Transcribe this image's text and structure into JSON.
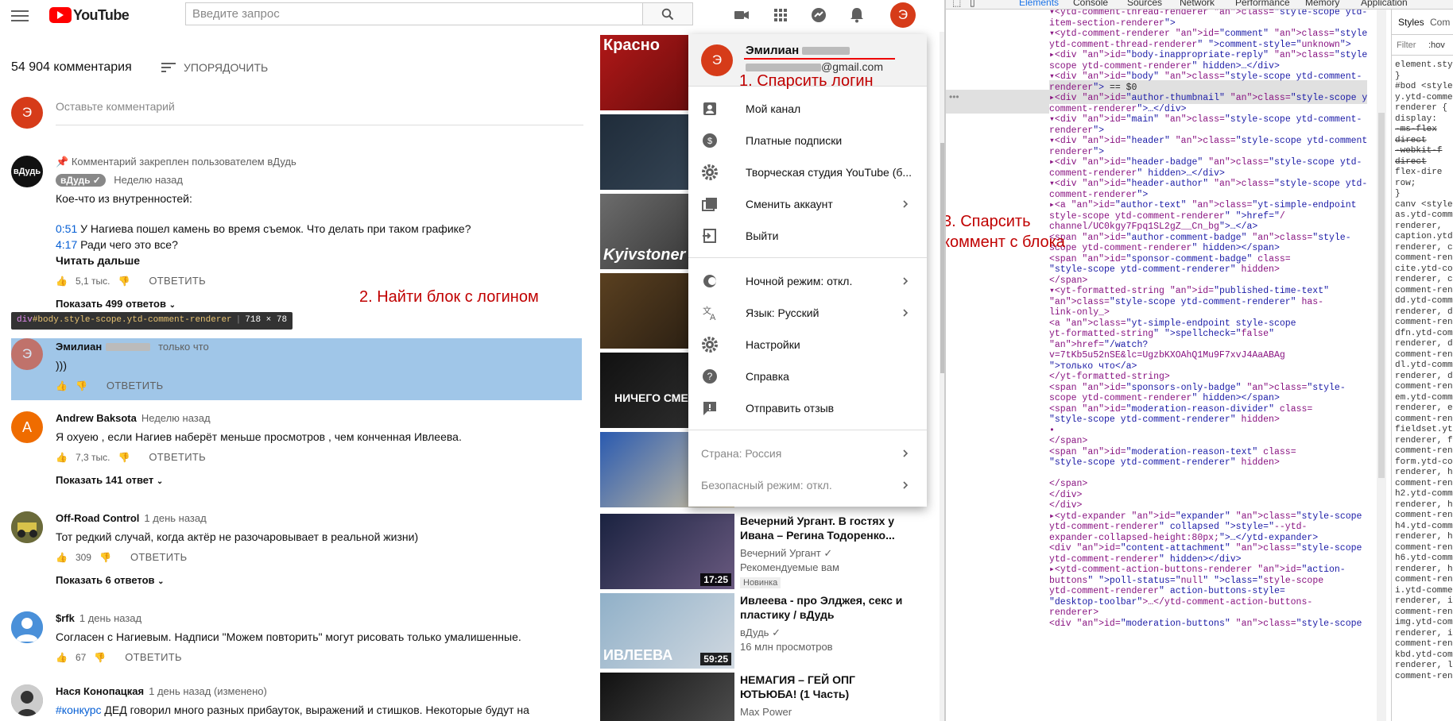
{
  "youtube": {
    "logo_text": "YouTube",
    "search": {
      "placeholder": "Введите запрос"
    },
    "header_icons": [
      "create-video-icon",
      "apps-icon",
      "messages-icon",
      "notifications-icon"
    ],
    "avatar_letter": "Э",
    "comments": {
      "count_label": "54 904 комментария",
      "sort_label": "УПОРЯДОЧИТЬ",
      "add_placeholder": "Оставьте комментарий",
      "pinned_label": "Комментарий закреплен пользователем вДудь",
      "items": [
        {
          "author": "вДудь",
          "time": "Неделю назад",
          "text_intro": "Кое-что из внутренностей:",
          "timestamps": [
            {
              "time": "0:51",
              "text": "У Нагиева пошел камень во время съемок. Что делать при таком графике?"
            },
            {
              "time": "4:17",
              "text": "Ради чего это все?"
            }
          ],
          "read_more": "Читать дальше",
          "likes": "5,1 тыс.",
          "reply": "ОТВЕТИТЬ",
          "show_replies": "Показать 499 ответов"
        },
        {
          "author": "Эмилиан",
          "time": "только что",
          "text": ")))",
          "reply": "ОТВЕТИТЬ"
        },
        {
          "author": "Andrew Baksota",
          "avatar_letter": "A",
          "time": "Неделю назад",
          "text": "Я охуею , если Нагиев наберёт меньше просмотров , чем конченная Ивлеева.",
          "likes": "7,3 тыс.",
          "reply": "ОТВЕТИТЬ",
          "show_replies": "Показать 141 ответ"
        },
        {
          "author": "Off-Road Control",
          "time": "1 день назад",
          "text": "Тот редкий случай, когда актёр не разочаровывает в реальной жизни)",
          "likes": "309",
          "reply": "ОТВЕТИТЬ",
          "show_replies": "Показать 6 ответов"
        },
        {
          "author": "$rfk",
          "time": "1 день назад",
          "text": "Согласен с Нагиевым. Надписи \"Можем повторить\" могут рисовать только умалишенные.",
          "likes": "67",
          "reply": "ОТВЕТИТЬ"
        },
        {
          "author": "Нася Конопацкая",
          "time": "1 день назад (изменено)",
          "hashtag": "#конкурс",
          "text": "ДЕД говорил много разных прибауток, выражений и стишков. Некоторые будут на"
        }
      ]
    },
    "inspector_tooltip": {
      "tag": "div",
      "selector": "#body.style-scope.ytd-comment-renderer",
      "size": "718 × 78"
    },
    "recommendations": {
      "thumb_labels": [
        "Красно",
        "",
        "Kyivstoner",
        "",
        "НИЧЕГО СМЕШНОГО",
        ""
      ],
      "items": [
        {
          "title": "Вечерний Ургант. В гостях у Ивана – Регина Тодоренко...",
          "channel": "Вечерний Ургант",
          "meta": "Рекомендуемые вам",
          "tag": "Новинка",
          "duration": "17:25"
        },
        {
          "title": "Ивлеева - про Элджея, секс и пластику / вДудь",
          "channel": "вДудь",
          "meta": "16 млн просмотров",
          "duration": "59:25",
          "thumb_text": "ИВЛЕЕВА"
        },
        {
          "title": "НЕМАГИЯ – ГЕЙ ОПГ ЮТЬЮБА! (1 Часть)",
          "channel": "Max Power"
        }
      ]
    },
    "account_menu": {
      "name": "Эмилиан",
      "email_suffix": "@gmail.com",
      "items": [
        {
          "label": "Мой канал",
          "icon": "channel-icon"
        },
        {
          "label": "Платные подписки",
          "icon": "paid-icon"
        },
        {
          "label": "Творческая студия YouTube (б...",
          "icon": "studio-gear-icon"
        },
        {
          "label": "Сменить аккаунт",
          "icon": "switch-account-icon",
          "chevron": true
        },
        {
          "label": "Выйти",
          "icon": "exit-icon"
        },
        {
          "label": "Ночной режим: откл.",
          "icon": "dark-mode-icon",
          "chevron": true
        },
        {
          "label": "Язык: Русский",
          "icon": "language-icon",
          "chevron": true
        },
        {
          "label": "Настройки",
          "icon": "settings-icon"
        },
        {
          "label": "Справка",
          "icon": "help-icon"
        },
        {
          "label": "Отправить отзыв",
          "icon": "feedback-icon"
        },
        {
          "label": "Страна: Россия",
          "chevron": true
        },
        {
          "label": "Безопасный режим: откл.",
          "chevron": true
        }
      ]
    },
    "annotations": {
      "a1": "1. Спарсить логин",
      "a2": "2. Найти блок с логином",
      "a3_line1": "3. Спарсить",
      "a3_line2": "коммент с блока"
    }
  },
  "devtools": {
    "tabs": [
      "Elements",
      "Console",
      "Sources",
      "Network",
      "Performance",
      "Memory",
      "Application"
    ],
    "active_tab": "Elements",
    "styles_tabs": [
      "Styles",
      "Com"
    ],
    "filter": "Filter",
    "hov": ":hov",
    "styles_lines": [
      "element.style",
      "}",
      "#bod <style>",
      "y.ytd-comment",
      "renderer {",
      "  display:",
      "  -ms-flex",
      "   direct",
      "  -webkit-f",
      "   direct",
      "  flex-dire",
      "   row;",
      "}",
      "canv <style>",
      "as.ytd-comme",
      "renderer,",
      "caption.ytd-",
      "renderer, ce",
      "comment-rend",
      "cite.ytd-com",
      "renderer, co",
      "comment-rend",
      "dd.ytd-comme",
      "renderer, de",
      "comment-rend",
      "dfn.ytd-comm",
      "renderer, di",
      "comment-rend",
      "dl.ytd-comme",
      "renderer, dt",
      "comment-rend",
      "em.ytd-comme",
      "renderer, em",
      "comment-rend",
      "fieldset.yt",
      "renderer, fo",
      "comment-rend",
      "form.ytd-com",
      "renderer, h1",
      "comment-rend",
      "h2.ytd-comme",
      "renderer, h3",
      "comment-rend",
      "h4.ytd-comme",
      "renderer, h5",
      "comment-rend",
      "h6.ytd-comme",
      "renderer, hr",
      "comment-rend",
      "i.ytd-comme",
      "renderer, if",
      "comment-rend",
      "img.ytd-comm",
      "renderer, in",
      "comment-rend",
      "kbd.ytd-comm",
      "renderer, la",
      "comment-rend"
    ],
    "elements_lines": [
      "▾<ytd-comment-thread-renderer class=\"style-scope ytd-",
      "item-section-renderer\">",
      "  ▾<ytd-comment-renderer id=\"comment\" class=\"style-scope",
      "  ytd-comment-thread-renderer\" comment-style=\"unknown\">",
      "    ▸<div id=\"body-inappropriate-reply\" class=\"style-",
      "    scope ytd-comment-renderer\" hidden>…</div>",
      "    ▾<div id=\"body\" class=\"style-scope ytd-comment-",
      "    renderer\"> == $0",
      "      ▸<div id=\"author-thumbnail\" class=\"style-scope ytd-",
      "      comment-renderer\">…</div>",
      "      ▾<div id=\"main\" class=\"style-scope ytd-comment-",
      "      renderer\">",
      "        ▾<div id=\"header\" class=\"style-scope ytd-comment-",
      "        renderer\">",
      "          ▸<div id=\"header-badge\" class=\"style-scope ytd-",
      "          comment-renderer\" hidden>…</div>",
      "          ▾<div id=\"header-author\" class=\"style-scope ytd-",
      "          comment-renderer\">",
      "            ▸<a id=\"author-text\" class=\"yt-simple-endpoint",
      "            style-scope ytd-comment-renderer\" href=\"/",
      "            channel/UC0kgy7Fpq1SL2gZ__Cn_bg\">…</a>",
      "              <span id=\"author-comment-badge\" class=\"style-",
      "              scope ytd-comment-renderer\" hidden></span>",
      "              <span id=\"sponsor-comment-badge\" class=",
      "              \"style-scope ytd-comment-renderer\" hidden>",
      "              </span>",
      "            ▾<yt-formatted-string id=\"published-time-text\"",
      "            class=\"style-scope ytd-comment-renderer\" has-",
      "            link-only_>",
      "                <a class=\"yt-simple-endpoint style-scope",
      "                yt-formatted-string\" spellcheck=\"false\"",
      "                href=\"/watch?",
      "                v=7tKb5u52nSE&lc=UgzbKXOAhQ1Mu9F7xvJ4AaABAg",
      "                \">только что</a>",
      "              </yt-formatted-string>",
      "              <span id=\"sponsors-only-badge\" class=\"style-",
      "              scope ytd-comment-renderer\" hidden></span>",
      "              <span id=\"moderation-reason-divider\" class=",
      "              \"style-scope ytd-comment-renderer\" hidden>",
      "                •",
      "              </span>",
      "              <span id=\"moderation-reason-text\" class=",
      "              \"style-scope ytd-comment-renderer\" hidden>",
      "",
      "              </span>",
      "          </div>",
      "        </div>",
      "        ▸<ytd-expander id=\"expander\" class=\"style-scope",
      "        ytd-comment-renderer\" collapsed style=\"--ytd-",
      "        expander-collapsed-height:80px;\">…</ytd-expander>",
      "          <div id=\"content-attachment\" class=\"style-scope",
      "          ytd-comment-renderer\" hidden></div>",
      "        ▸<ytd-comment-action-buttons-renderer id=\"action-",
      "        buttons\" poll-status=\"null\" class=\"style-scope",
      "        ytd-comment-renderer\" action-buttons-style=",
      "        \"desktop-toolbar\">…</ytd-comment-action-buttons-",
      "        renderer>",
      "          <div id=\"moderation-buttons\" class=\"style-scope"
    ]
  }
}
